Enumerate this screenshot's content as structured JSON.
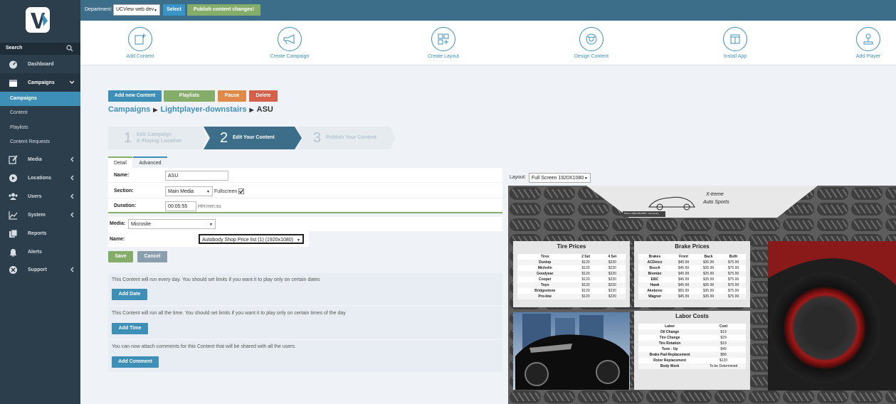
{
  "sidebar": {
    "search_label": "Search",
    "nav": {
      "dashboard": "Dashboard",
      "campaigns": "Campaigns",
      "media": "Media",
      "locations": "Locations",
      "users": "Users",
      "system": "System",
      "reports": "Reports",
      "alerts": "Alerts",
      "support": "Support"
    },
    "sub": {
      "campaigns": "Campaigns",
      "content": "Content",
      "playlists": "Playlists",
      "content_requests": "Content Requests"
    }
  },
  "topbar": {
    "department_label": "Department:",
    "department_value": "UCView web dev",
    "select_button": "Select",
    "publish_button": "Publish content changes!"
  },
  "quick_actions": {
    "add_content": "Add Content",
    "create_campaign": "Create Campaign",
    "create_layout": "Create Layout",
    "design_content": "Design Content",
    "install_app": "Install App",
    "add_player": "Add Player"
  },
  "actions": {
    "add_new_content": "Add new Content",
    "playlists": "Playlists",
    "pause": "Pause",
    "delete": "Delete"
  },
  "breadcrumb": {
    "root": "Campaigns",
    "parent": "Lightplayer-downstairs",
    "current": "ASU"
  },
  "wizard": {
    "step1_num": "1",
    "step1_line1": "Edit Campaign",
    "step1_line2": "& Playing Location",
    "step2_num": "2",
    "step2_label": "Edit Your Content",
    "step3_num": "3",
    "step3_label": "Publish Your Content"
  },
  "tabs": {
    "detail": "Detail",
    "advanced": "Advanced"
  },
  "form": {
    "name_label": "Name:",
    "name_value": "ASU",
    "section_label": "Section:",
    "section_value": "Main Media",
    "fullscreen_label": "Fullscreen",
    "duration_label": "Duration:",
    "duration_value": "00:05:55",
    "duration_hint": "HH:mm:ss",
    "media_label": "Media:",
    "media_value": "Microsite",
    "media_name_label": "Name:",
    "media_name_value": "Autobody Shop Price list (1) (1920x1080)",
    "save": "Save",
    "cancel": "Cancel"
  },
  "info": {
    "date_text": "This Content will run every day. You should set limits if you want it to play only on certain dates",
    "add_date": "Add Date",
    "time_text": "This Content will run all the time. You should set limits if you want it to play only on certain times of the day",
    "add_time": "Add Time",
    "comment_text": "You can now attach comments for this Content that will be shared with all the users.",
    "add_comment": "Add Comment"
  },
  "preview": {
    "layout_label": "Layout:",
    "layout_value": "Full Screen 1920X1080",
    "logo_line1": "X-treme",
    "logo_line2": "Auto Sports",
    "tagline": "Phone: (555) 555-5555  ·  Full service",
    "tire_title": "Tire Prices",
    "tire_headers": [
      "Tires",
      "2 Set",
      "4 Set"
    ],
    "tire_rows": [
      [
        "Dunlop",
        "$120",
        "$220"
      ],
      [
        "Michelin",
        "$120",
        "$220"
      ],
      [
        "Goodyear",
        "$120",
        "$220"
      ],
      [
        "Cooper",
        "$120",
        "$220"
      ],
      [
        "Toyo",
        "$120",
        "$220"
      ],
      [
        "Bridgestone",
        "$120",
        "$220"
      ],
      [
        "Pro-line",
        "$120",
        "$220"
      ]
    ],
    "brake_title": "Brake Prices",
    "brake_headers": [
      "Brakes",
      "Front",
      "Back",
      "Both"
    ],
    "brake_rows": [
      [
        "ACDelco",
        "$45.99",
        "$35.99",
        "$75.99"
      ],
      [
        "Bosch",
        "$45.99",
        "$35.99",
        "$75.99"
      ],
      [
        "Brembo",
        "$45.99",
        "$25.99",
        "$75.99"
      ],
      [
        "EBC",
        "$45.99",
        "$35.99",
        "$75.99"
      ],
      [
        "Hawk",
        "$45.99",
        "$35.99",
        "$75.99"
      ],
      [
        "Akebono",
        "$55.99",
        "$35.99",
        "$75.99"
      ],
      [
        "Wagner",
        "$45.99",
        "$35.99",
        "$75.99"
      ]
    ],
    "labor_title": "Labor Costs",
    "labor_headers": [
      "Labor",
      "Cost"
    ],
    "labor_rows": [
      [
        "Oil Change",
        "$19"
      ],
      [
        "Tire Change",
        "$29"
      ],
      [
        "Tire Rotation",
        "$19"
      ],
      [
        "Tune - Up",
        "$49"
      ],
      [
        "Brake Pad Replacement",
        "$89"
      ],
      [
        "Rotor Replacement",
        "$120"
      ],
      [
        "Body Work",
        "To be Determined"
      ]
    ]
  },
  "colors": {
    "sidebar_bg": "#2c3e4c",
    "topbar_bg": "#3c6e8a",
    "accent_blue": "#3d8fb8",
    "green": "#84ad6a",
    "orange": "#e08a4a",
    "red": "#d5604c",
    "gray_btn": "#8a9eae"
  }
}
